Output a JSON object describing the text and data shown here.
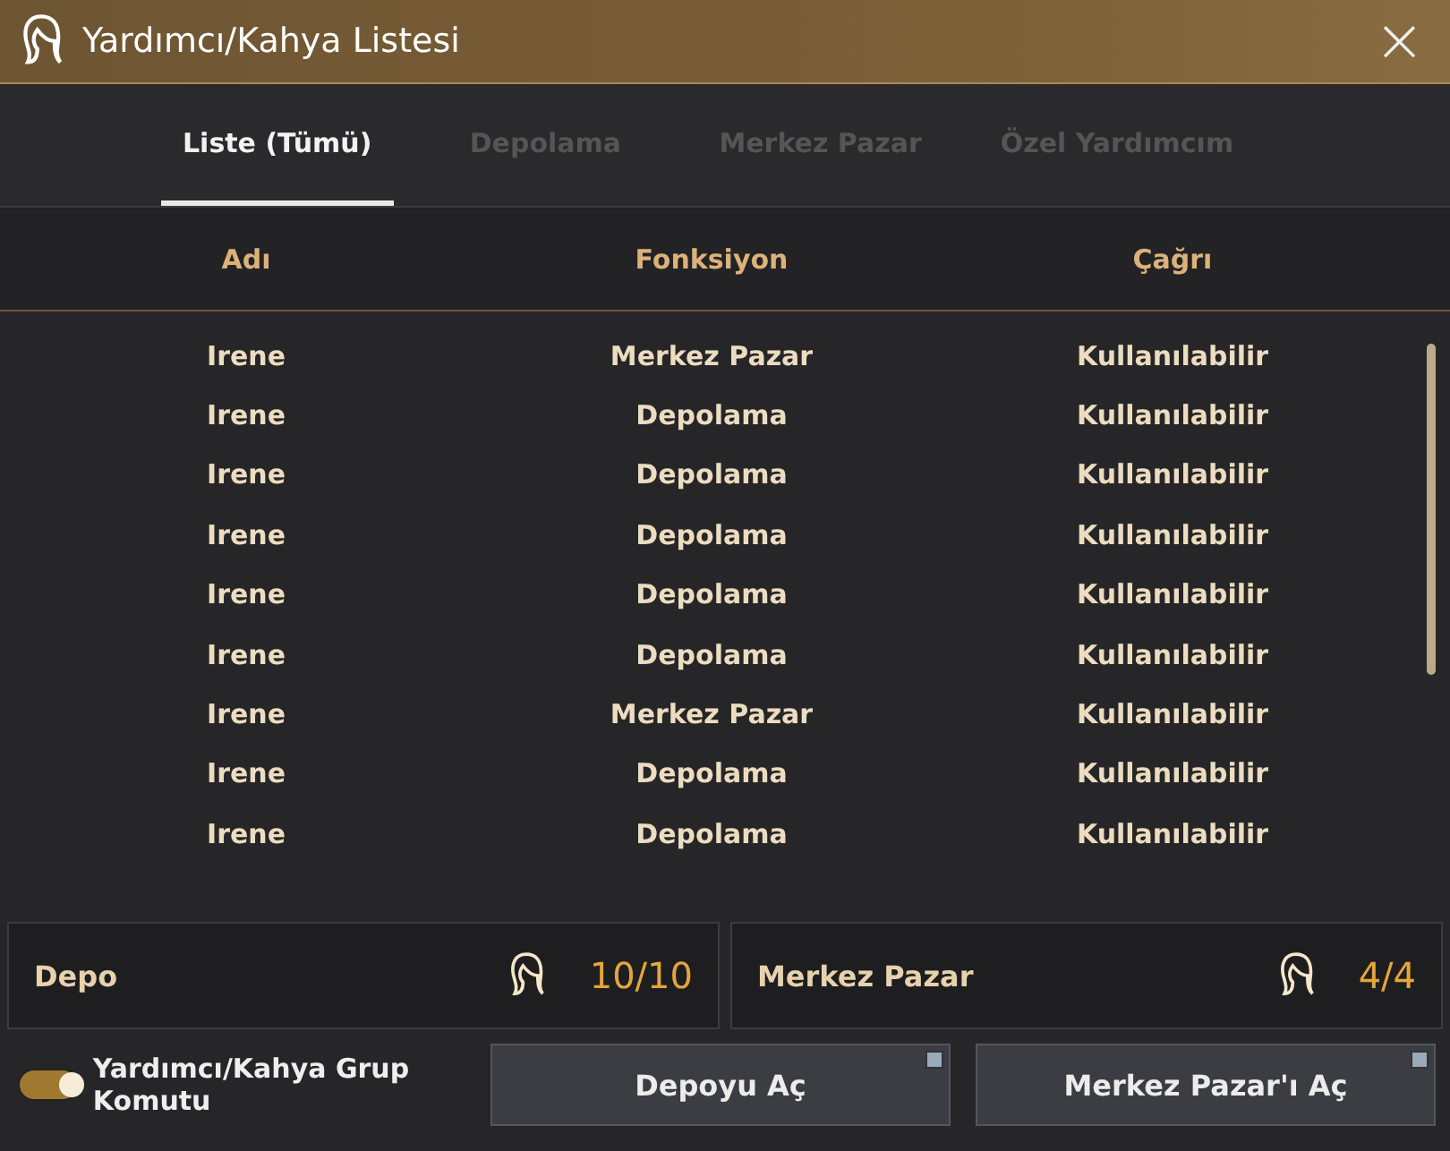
{
  "window": {
    "title": "Yardımcı/Kahya Listesi",
    "close": "×"
  },
  "tabs": [
    {
      "label": "Liste (Tümü)",
      "selected": true
    },
    {
      "label": "Depolama",
      "selected": false
    },
    {
      "label": "Merkez Pazar",
      "selected": false
    },
    {
      "label": "Özel Yardımcım",
      "selected": false
    }
  ],
  "table": {
    "columns": [
      "Adı",
      "Fonksiyon",
      "Çağrı"
    ],
    "rows": [
      [
        "Irene",
        "Merkez Pazar",
        "Kullanılabilir"
      ],
      [
        "Irene",
        "Depolama",
        "Kullanılabilir"
      ],
      [
        "Irene",
        "Depolama",
        "Kullanılabilir"
      ],
      [
        "Irene",
        "Depolama",
        "Kullanılabilir"
      ],
      [
        "Irene",
        "Depolama",
        "Kullanılabilir"
      ],
      [
        "Irene",
        "Depolama",
        "Kullanılabilir"
      ],
      [
        "Irene",
        "Merkez Pazar",
        "Kullanılabilir"
      ],
      [
        "Irene",
        "Depolama",
        "Kullanılabilir"
      ],
      [
        "Irene",
        "Depolama",
        "Kullanılabilir"
      ]
    ]
  },
  "counters": [
    {
      "label": "Depo",
      "count": "10/10"
    },
    {
      "label": "Merkez Pazar",
      "count": "4/4"
    }
  ],
  "group_toggle": {
    "label": "Yardımcı/Kahya Grup Komutu",
    "on": true
  },
  "buttons": [
    "Depoyu Aç",
    "Merkez Pazar'ı Aç"
  ]
}
